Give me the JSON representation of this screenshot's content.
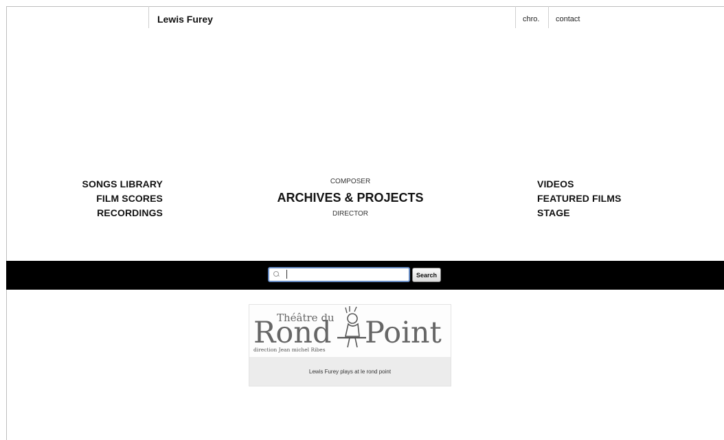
{
  "header": {
    "site_title": "Lewis Furey",
    "links": {
      "chrono": "chro.",
      "contact": "contact"
    }
  },
  "nav": {
    "left": [
      "SONGS LIBRARY",
      "FILM SCORES",
      "RECORDINGS"
    ],
    "center": {
      "top": "COMPOSER",
      "main": "ARCHIVES & PROJECTS",
      "bottom": "DIRECTOR"
    },
    "right": [
      "VIDEOS",
      "FEATURED FILMS",
      "STAGE"
    ]
  },
  "search": {
    "value": "",
    "button_label": "Search",
    "icon": "search-icon"
  },
  "promo": {
    "logo_line1": "Théâtre du",
    "logo_main_left": "Rond",
    "logo_main_right": "Point",
    "logo_sub": "direction Jean michel Ribes",
    "caption": "Lewis Furey plays at le rond point"
  },
  "colors": {
    "bar": "#000000",
    "search_border": "#6a8fc7",
    "promo_bg": "#ececec"
  }
}
